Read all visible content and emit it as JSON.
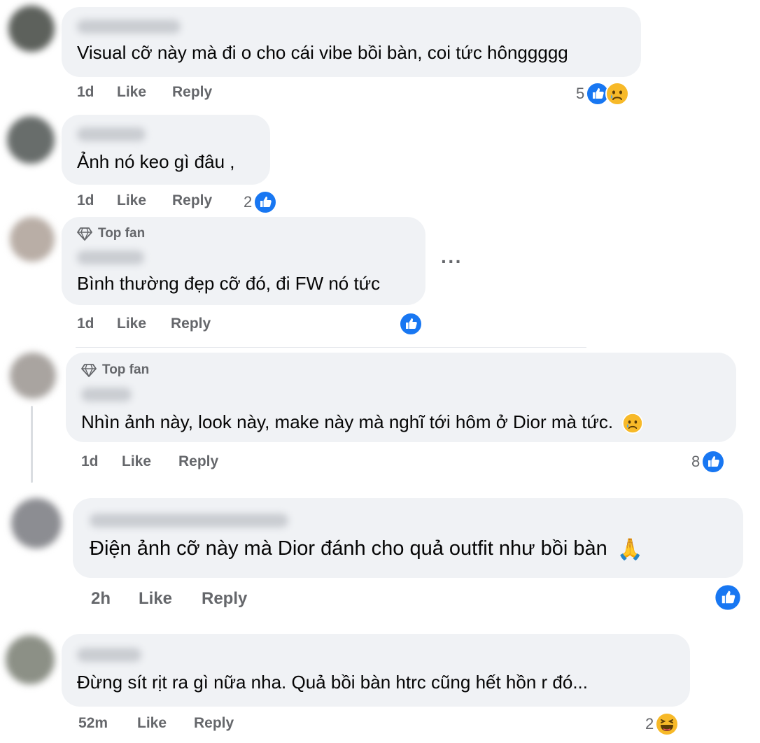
{
  "comments": [
    {
      "text": "Visual cỡ này mà đi o cho cái vibe bồi bàn, coi tức hônggggg",
      "time": "1d",
      "like_label": "Like",
      "reply_label": "Reply",
      "reaction_count": "5",
      "reactions": [
        "like-icon",
        "sad-icon"
      ]
    },
    {
      "text": "Ảnh nó keo gì đâu ,",
      "time": "1d",
      "like_label": "Like",
      "reply_label": "Reply",
      "reaction_count": "2",
      "reactions": [
        "like-icon"
      ]
    },
    {
      "badge": "Top fan",
      "text": "Bình thường đẹp cỡ đó, đi FW nó tức",
      "time": "1d",
      "like_label": "Like",
      "reply_label": "Reply",
      "reaction_count": "",
      "reactions": [
        "like-icon"
      ],
      "more_label": "···"
    },
    {
      "badge": "Top fan",
      "text": "Nhìn ảnh này, look này, make này mà nghĩ tới hôm ở Dior mà tức.",
      "text_emoji": "crying-face",
      "time": "1d",
      "like_label": "Like",
      "reply_label": "Reply",
      "reaction_count": "8",
      "reactions": [
        "like-icon"
      ]
    },
    {
      "text": "Điện ảnh cỡ này mà Dior đánh cho quả outfit như bồi bàn",
      "text_emoji": "folded-hands",
      "time": "2h",
      "like_label": "Like",
      "reply_label": "Reply",
      "reaction_count": "",
      "reactions": [
        "like-icon"
      ]
    },
    {
      "text": "Đừng sít rịt ra gì nữa nha. Quả bồi bàn htrc cũng hết hồn r đó...",
      "time": "52m",
      "like_label": "Like",
      "reply_label": "Reply",
      "reaction_count": "2",
      "reactions": [
        "haha-icon"
      ]
    }
  ],
  "colors": {
    "bubble": "#f0f2f5",
    "meta_text": "#65676b",
    "like_blue": "#1877f2",
    "emoji_yellow": "#f7b928"
  }
}
